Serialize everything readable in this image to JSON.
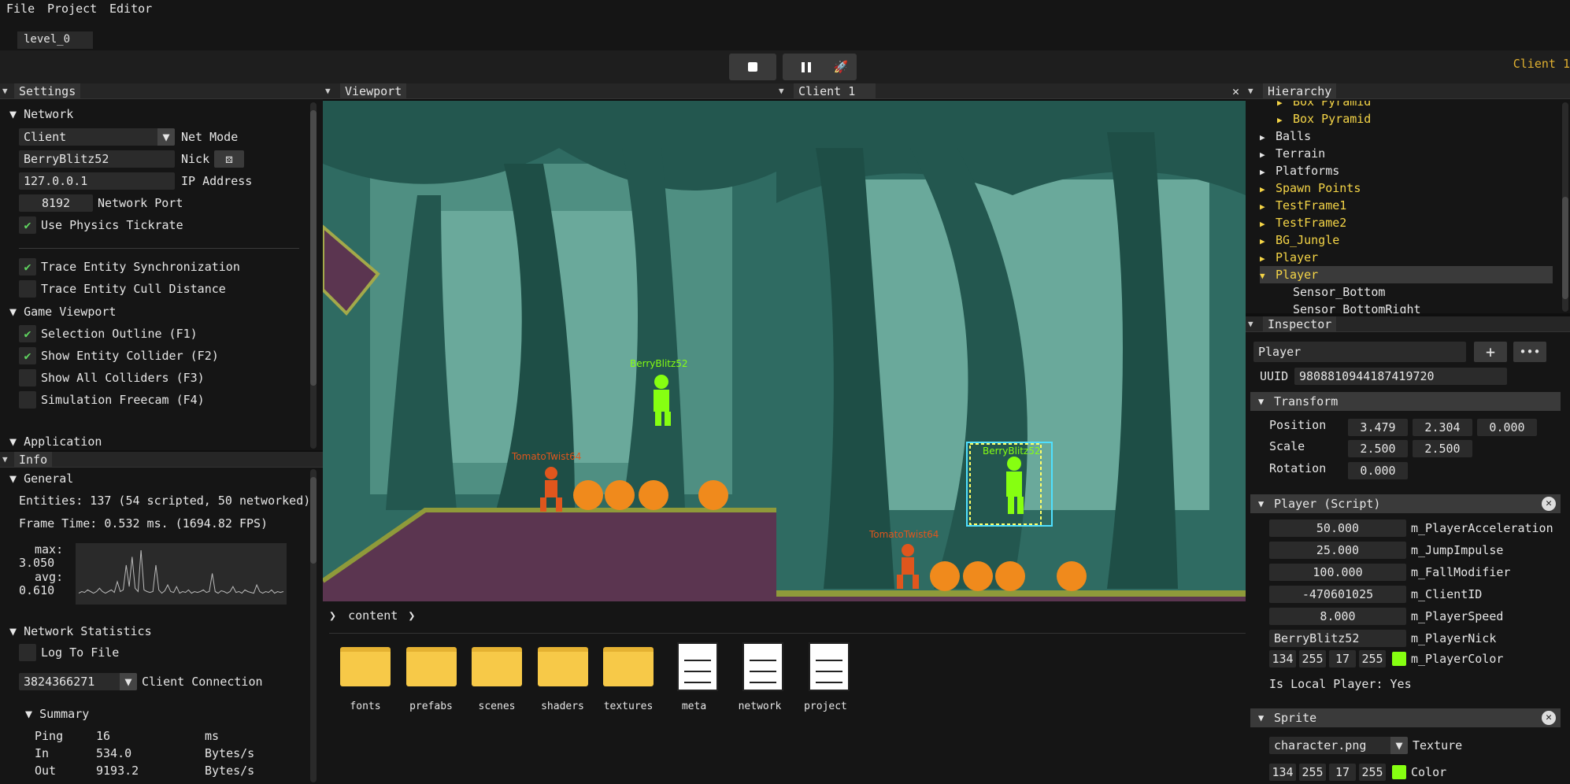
{
  "menu": [
    "File",
    "Project",
    "Editor"
  ],
  "scene_tab": "level_0",
  "toolbar": {
    "client_label": "Client 1"
  },
  "settings": {
    "title": "Settings",
    "network_section": "Network",
    "net_mode_value": "Client",
    "net_mode_label": "Net Mode",
    "nick_value": "BerryBlitz52",
    "nick_label": "Nick",
    "ip_value": "127.0.0.1",
    "ip_label": "IP Address",
    "port_value": "8192",
    "port_label": "Network Port",
    "use_physics": "Use Physics Tickrate",
    "trace_sync": "Trace Entity Synchronization",
    "trace_cull": "Trace Entity Cull Distance",
    "game_viewport_section": "Game Viewport",
    "selection_outline": "Selection Outline (F1)",
    "show_collider": "Show Entity Collider (F2)",
    "show_all_colliders": "Show All Colliders (F3)",
    "sim_freecam": "Simulation Freecam (F4)",
    "application_section": "Application"
  },
  "info": {
    "title": "Info",
    "general_section": "General",
    "entities": "Entities: 137 (54 scripted, 50 networked)",
    "frame_time": "Frame Time: 0.532 ms. (1694.82 FPS)",
    "max_label": "max:",
    "max_value": "3.050",
    "avg_label": "avg:",
    "avg_value": "0.610",
    "frame_graph": [
      0.4,
      0.5,
      0.45,
      0.6,
      0.5,
      0.4,
      0.5,
      0.7,
      0.5,
      0.4,
      0.5,
      0.6,
      0.45,
      1.1,
      0.5,
      0.6,
      2.1,
      0.8,
      2.6,
      0.7,
      0.5,
      3.0,
      0.6,
      0.5,
      0.45,
      0.5,
      2.1,
      0.6,
      0.4,
      0.55,
      0.9,
      0.5,
      0.45,
      0.8,
      0.4,
      0.5,
      0.45,
      0.6,
      0.4,
      0.5,
      0.45,
      0.5,
      0.6,
      0.45,
      0.5,
      1.6,
      0.5,
      0.4,
      0.55,
      0.5,
      0.4,
      0.5,
      0.8,
      0.45,
      0.5,
      0.4,
      0.6,
      0.5,
      0.45,
      0.4,
      0.9,
      0.5,
      0.4,
      0.5,
      0.45,
      0.6,
      0.4,
      0.5,
      0.45,
      0.5
    ],
    "net_stats_section": "Network Statistics",
    "log_to_file": "Log To File",
    "client_conn_value": "3824366271",
    "client_conn_label": "Client Connection",
    "summary_section": "Summary",
    "stats": [
      {
        "name": "Ping",
        "value": "16",
        "unit": "ms"
      },
      {
        "name": "In",
        "value": "534.0",
        "unit": "Bytes/s"
      },
      {
        "name": "Out",
        "value": "9193.2",
        "unit": "Bytes/s"
      }
    ]
  },
  "viewport": {
    "title": "Viewport",
    "player_label": "BerryBlitz52",
    "enemy_label": "TomatoTwist64"
  },
  "client_view": {
    "title": "Client 1",
    "player_label": "BerryBlitz52",
    "enemy_label": "TomatoTwist64"
  },
  "content": {
    "breadcrumb": "content",
    "folders": [
      "fonts",
      "prefabs",
      "scenes",
      "shaders",
      "textures"
    ],
    "files": [
      "meta",
      "network",
      "project"
    ]
  },
  "hierarchy": {
    "title": "Hierarchy",
    "items": [
      {
        "label": "Box Pyramid",
        "arrow": "▶",
        "indent": 1,
        "color": "#f5d547"
      },
      {
        "label": "Box Pyramid",
        "arrow": "▶",
        "indent": 1,
        "color": "#f5d547"
      },
      {
        "label": "Balls",
        "arrow": "▶",
        "indent": 0,
        "color": "#e6e6e6"
      },
      {
        "label": "Terrain",
        "arrow": "▶",
        "indent": 0,
        "color": "#e6e6e6"
      },
      {
        "label": "Platforms",
        "arrow": "▶",
        "indent": 0,
        "color": "#e6e6e6"
      },
      {
        "label": "Spawn Points",
        "arrow": "▶",
        "indent": 0,
        "color": "#f5d547"
      },
      {
        "label": "TestFrame1",
        "arrow": "▶",
        "indent": 0,
        "color": "#f5d547"
      },
      {
        "label": "TestFrame2",
        "arrow": "▶",
        "indent": 0,
        "color": "#f5d547"
      },
      {
        "label": "BG_Jungle",
        "arrow": "▶",
        "indent": 0,
        "color": "#f5d547"
      },
      {
        "label": "Player",
        "arrow": "▶",
        "indent": 0,
        "color": "#f5d547"
      },
      {
        "label": "Player",
        "arrow": "▼",
        "indent": 0,
        "color": "#f5d547",
        "selected": true
      },
      {
        "label": "Sensor_Bottom",
        "arrow": "",
        "indent": 1,
        "color": "#e6e6e6"
      },
      {
        "label": "Sensor_BottomRight",
        "arrow": "",
        "indent": 1,
        "color": "#e6e6e6"
      }
    ]
  },
  "inspector": {
    "title": "Inspector",
    "entity_name": "Player",
    "uuid_label": "UUID",
    "uuid_value": "9808810944187419720",
    "transform_header": "Transform",
    "position_label": "Position",
    "position": [
      "3.479",
      "2.304",
      "0.000"
    ],
    "scale_label": "Scale",
    "scale": [
      "2.500",
      "2.500"
    ],
    "rotation_label": "Rotation",
    "rotation": [
      "0.000"
    ],
    "script_header": "Player (Script)",
    "script_fields": [
      {
        "value": "50.000",
        "name": "m_PlayerAcceleration"
      },
      {
        "value": "25.000",
        "name": "m_JumpImpulse"
      },
      {
        "value": "100.000",
        "name": "m_FallModifier"
      },
      {
        "value": "-470601025",
        "name": "m_ClientID"
      },
      {
        "value": "8.000",
        "name": "m_PlayerSpeed"
      },
      {
        "value": "BerryBlitz52",
        "name": "m_PlayerNick"
      }
    ],
    "player_color": [
      "134",
      "255",
      "17",
      "255"
    ],
    "player_color_label": "m_PlayerColor",
    "player_color_hex": "#86ff11",
    "is_local": "Is Local Player: Yes",
    "sprite_header": "Sprite",
    "texture_value": "character.png",
    "texture_label": "Texture",
    "sprite_color": [
      "134",
      "255",
      "17",
      "255"
    ],
    "sprite_color_label": "Color"
  }
}
